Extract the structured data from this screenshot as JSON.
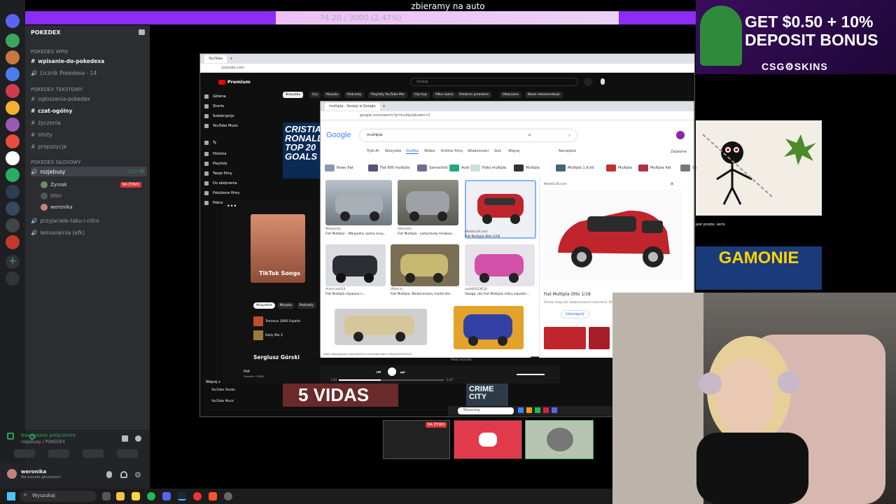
{
  "stream": {
    "title": "zbieramy na auto",
    "progress_text": "74.20 / 3000 (2.47%)",
    "progress_fraction": 0.0247
  },
  "discord": {
    "server_name": "POKEDEX",
    "categories": {
      "wpis": "POKEDEX Wpis",
      "tekstowy": "POKEDEX Tekstowy",
      "glosowy": "POKEDEX GŁOSOWY"
    },
    "channels": {
      "wpisanie": "wpisanie-do-pokedexa",
      "licznik": "Licznik Pokedexa - 14",
      "ogloszenia": "ogłoszenia-pokedex",
      "czat": "czat-ogólny",
      "zyczenia": "życzenia",
      "shoty": "shoty",
      "propozycje": "propozycje",
      "rozjebusy": "rozjebusy",
      "przyjaciele": "przyjaciele-taku-i-nitro",
      "lamusiarnia": "lamusiarnia (afk)"
    },
    "voice_time": "1:17:38",
    "members": [
      {
        "name": "Żyniak",
        "badge": "NA ŻYWO"
      },
      {
        "name": "DGU",
        "badge": ""
      },
      {
        "name": "weronika",
        "badge": ""
      }
    ],
    "connection": {
      "status": "Nawiązano połączenie",
      "detail": "rozjebusy / POKEDEX"
    },
    "user": {
      "name": "weronika",
      "status": "Na kanale głosowym"
    }
  },
  "youtube": {
    "tab": "YouTube",
    "url": "youtube.com",
    "brand": "Premium",
    "search_placeholder": "Szukaj",
    "chips": [
      "Wszystko",
      "Gry",
      "Muzyka",
      "Podcasty",
      "Playlisty YouTube Mix",
      "Hip-hop",
      "Piłka nożna",
      "Ostatnio przesłane",
      "Obejrzane",
      "Nowe rekomendacje"
    ],
    "nav": [
      "Główna",
      "Shorts",
      "Subskrypcje",
      "YouTube Music",
      "Ty",
      "Historia",
      "Playlisty",
      "Twoje filmy",
      "Do obejrzenia",
      "Polubione filmy",
      "Pobrane"
    ],
    "thumb_text": "CRISTIANO RONALDO TOP 20 GOALS",
    "bottom_text": "5 VIDAS",
    "bottom_text2": "CRIME CITY",
    "right_caption": "jest proste, serio",
    "gamonie": "GAMONIE",
    "more_label": "Więcej z",
    "studio": "YouTube Studio",
    "music": "YouTube Music"
  },
  "spotify": {
    "album_label": "TikTok Songs",
    "chips": [
      "Wszystkie",
      "Muzyka",
      "Podcasty"
    ],
    "items": [
      "Tomasso 2000 España",
      "Daily Mix 2"
    ],
    "artist": "Sergiusz Górski",
    "track": "Hot",
    "track_artist": "Telestisk • RRNA",
    "time_start": "1:34",
    "time_end": "3:37"
  },
  "google": {
    "tab": "multipla - Szukaj w Google",
    "url": "google.com/search?q=multipla&udm=2",
    "logo": "Google",
    "query": "multipla",
    "filters": [
      "Tryb AI",
      "Wszystko",
      "Grafika",
      "Wideo",
      "Krótkie filmy",
      "Wiadomości",
      "Sieć",
      "Więcej"
    ],
    "tools": "Narzędzia",
    "saved": "Zapisane",
    "related": [
      "Nowy fiat",
      "Fiat 600 multipla",
      "Samochód",
      "Auto",
      "Fiata multipla",
      "Multipla",
      "Multipla 1.9 jtd",
      "Multipla",
      "Multipla fiat",
      "Sa"
    ],
    "results": [
      {
        "source": "Wikipedia",
        "title": "Fiat Multipla – Wikipedia, wolna ency..."
      },
      {
        "source": "Otomoto",
        "title": "Fiat Multipla - samochody Osobow..."
      },
      {
        "source": "Models18.com",
        "title": "Fiat Multipla Otto 1/18"
      },
      {
        "source": "Autocrash24",
        "title": "Fiat Multipla używane n..."
      },
      {
        "source": "Vitae.io",
        "title": "Fiat Multipla. Niedoceniany model któ..."
      },
      {
        "source": "autoKOLEKCJA",
        "title": "Uwaga, oto Fiat Multipla, który zapadni..."
      }
    ],
    "preview_source": "Models18.com",
    "preview_title": "Fiat Multipla Otto 1/18",
    "preview_note": "Obrazy mogą być objęte prawami autorskimi. Więcej",
    "share": "Udostępnij",
    "status_url": "https://www.google.com/imgres?q=multipla&imgurl=https%3A%2F%2F...",
    "show_all": "Pokaż wszystko"
  },
  "taskbar": {
    "search": "Wyszukaj",
    "inner_search": "Wyszukaj",
    "live_badge": "NA ŻYWO"
  },
  "ad": {
    "line1": "GET $0.50 + 10%",
    "line2": "DEPOSIT BONUS",
    "brand": "CSG⚙SKINS"
  },
  "colors": {
    "progress": "#8b2cf5",
    "discord_bg": "#2b2d31",
    "live_red": "#da373c",
    "connected_green": "#23a55a",
    "car_red": "#c0242c"
  }
}
